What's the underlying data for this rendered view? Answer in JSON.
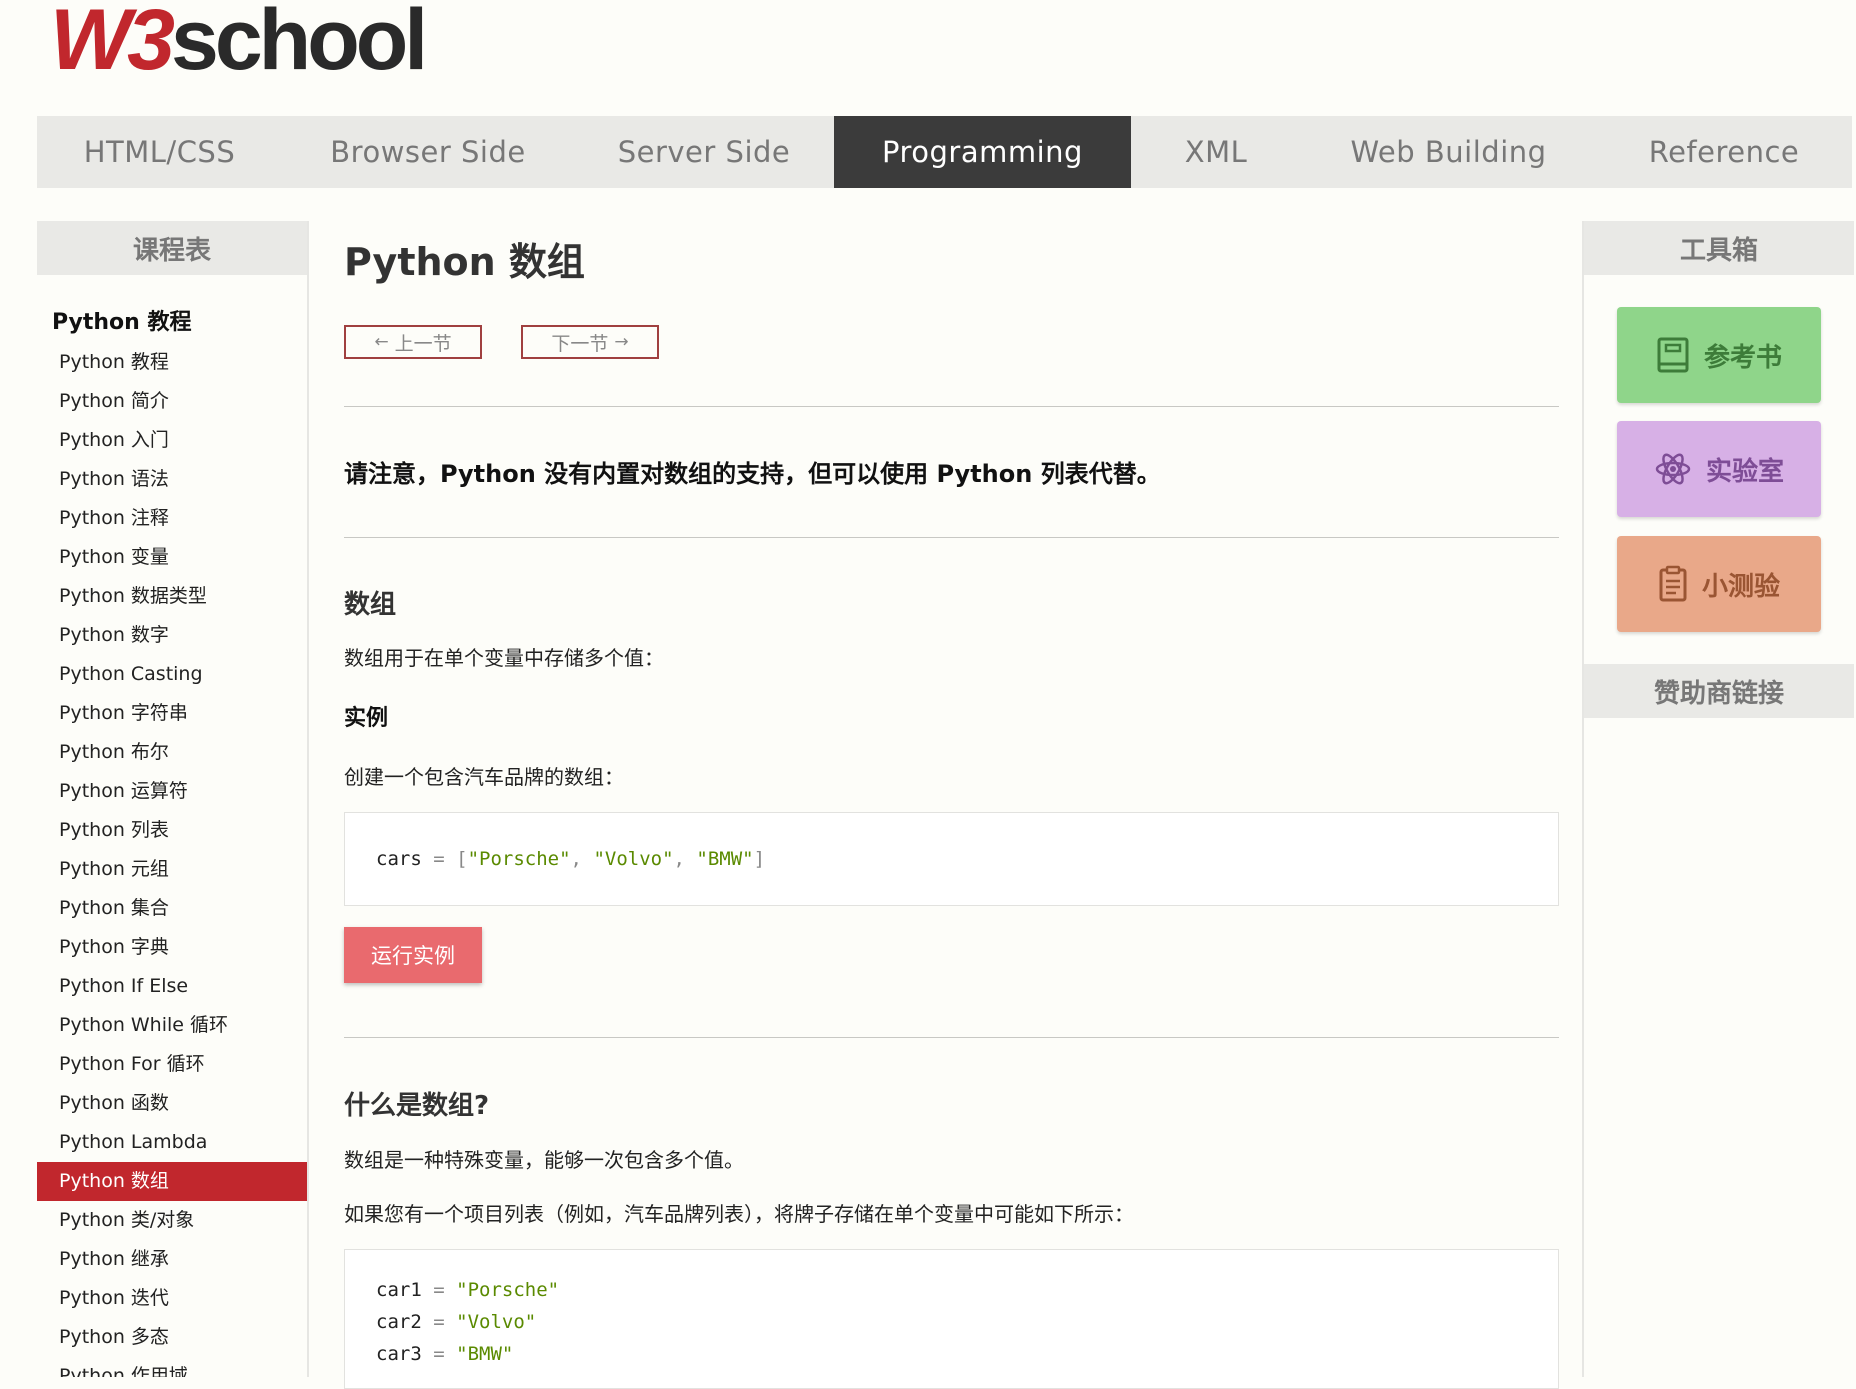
{
  "logo": {
    "part1": "W3",
    "part2": "school"
  },
  "topnav": [
    {
      "label": "HTML/CSS",
      "active": false
    },
    {
      "label": "Browser Side",
      "active": false
    },
    {
      "label": "Server Side",
      "active": false
    },
    {
      "label": "Programming",
      "active": true
    },
    {
      "label": "XML",
      "active": false
    },
    {
      "label": "Web Building",
      "active": false
    },
    {
      "label": "Reference",
      "active": false
    }
  ],
  "leftbar": {
    "heading": "课程表",
    "title": "Python 教程",
    "items": [
      "Python 教程",
      "Python 简介",
      "Python 入门",
      "Python 语法",
      "Python 注释",
      "Python 变量",
      "Python 数据类型",
      "Python 数字",
      "Python Casting",
      "Python 字符串",
      "Python 布尔",
      "Python 运算符",
      "Python 列表",
      "Python 元组",
      "Python 集合",
      "Python 字典",
      "Python If Else",
      "Python While 循环",
      "Python For 循环",
      "Python 函数",
      "Python Lambda",
      "Python 数组",
      "Python 类/对象",
      "Python 继承",
      "Python 迭代",
      "Python 多态",
      "Python 作用域"
    ],
    "active_item": "Python 数组"
  },
  "rightbar": {
    "heading": "工具箱",
    "tools": {
      "reference": "参考书",
      "lab": "实验室",
      "quiz": "小测验"
    },
    "sponsor": "赞助商链接",
    "colors": {
      "reference": "#8fd58a",
      "lab": "#d7b0e6",
      "quiz": "#e9a889"
    }
  },
  "main": {
    "title": "Python 数组",
    "prev_label": "上一节",
    "next_label": "下一节",
    "note": "请注意，Python 没有内置对数组的支持，但可以使用 Python 列表代替。",
    "section1": {
      "heading": "数组",
      "text": "数组用于在单个变量中存储多个值：",
      "example_heading": "实例",
      "example_text": "创建一个包含汽车品牌的数组：",
      "code": {
        "var": "cars",
        "op": "=",
        "open": "[",
        "s1": "\"Porsche\"",
        "s2": "\"Volvo\"",
        "s3": "\"BMW\"",
        "close": "]",
        "comma": ","
      },
      "run_label": "运行实例"
    },
    "section2": {
      "heading": "什么是数组?",
      "text1": "数组是一种特殊变量，能够一次包含多个值。",
      "text2": "如果您有一个项目列表（例如，汽车品牌列表），将牌子存储在单个变量中可能如下所示：",
      "code": [
        {
          "var": "car1",
          "op": "=",
          "val": "\"Porsche\""
        },
        {
          "var": "car2",
          "op": "=",
          "val": "\"Volvo\""
        },
        {
          "var": "car3",
          "op": "=",
          "val": "\"BMW\""
        }
      ]
    }
  },
  "colors": {
    "brand_red": "#c1272d",
    "nav_active": "#3b3b3b",
    "run_button": "#e96a6e"
  }
}
